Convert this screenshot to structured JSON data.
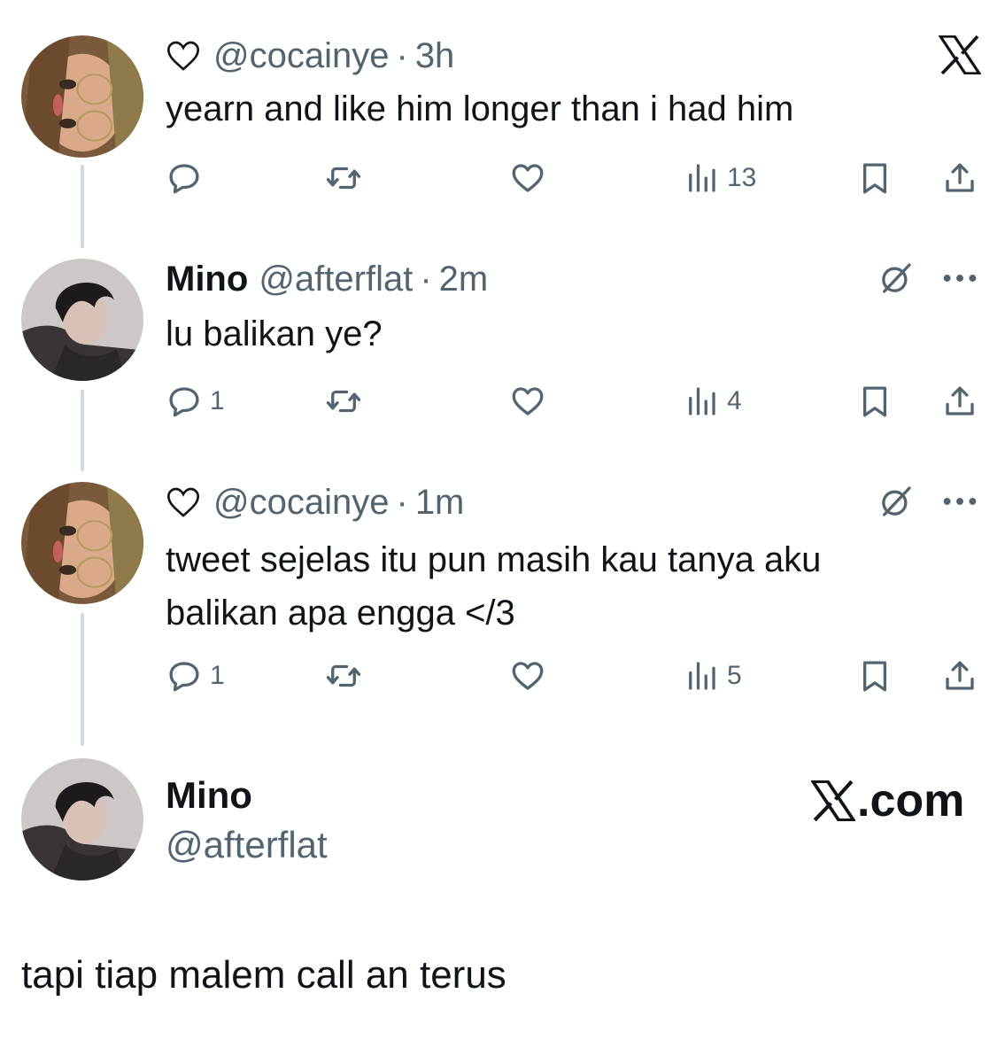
{
  "brand_logo": "x-logo-icon",
  "tweets": [
    {
      "author_name": "",
      "handle": "@cocainye",
      "time": "3h",
      "text_lines": [
        "yearn and like him longer than i had him"
      ],
      "replies": "",
      "views": "13",
      "has_heart_prefix": true
    },
    {
      "author_name": "Mino",
      "handle": "@afterflat",
      "time": "2m",
      "text_lines": [
        "lu balikan ye?"
      ],
      "replies": "1",
      "views": "4",
      "has_heart_prefix": false
    },
    {
      "author_name": "",
      "handle": "@cocainye",
      "time": "1m",
      "text_lines": [
        "tweet sejelas itu pun masih kau tanya aku",
        "balikan apa engga </3"
      ],
      "replies": "1",
      "views": "5",
      "has_heart_prefix": true
    }
  ],
  "separator": "·",
  "profile_card": {
    "name": "Mino",
    "handle": "@afterflat",
    "site": ".com"
  },
  "caption": "tapi tiap malem call an terus",
  "colors": {
    "text_primary": "#0f1419",
    "text_secondary": "#536471",
    "thread_line": "#cfd9de"
  }
}
